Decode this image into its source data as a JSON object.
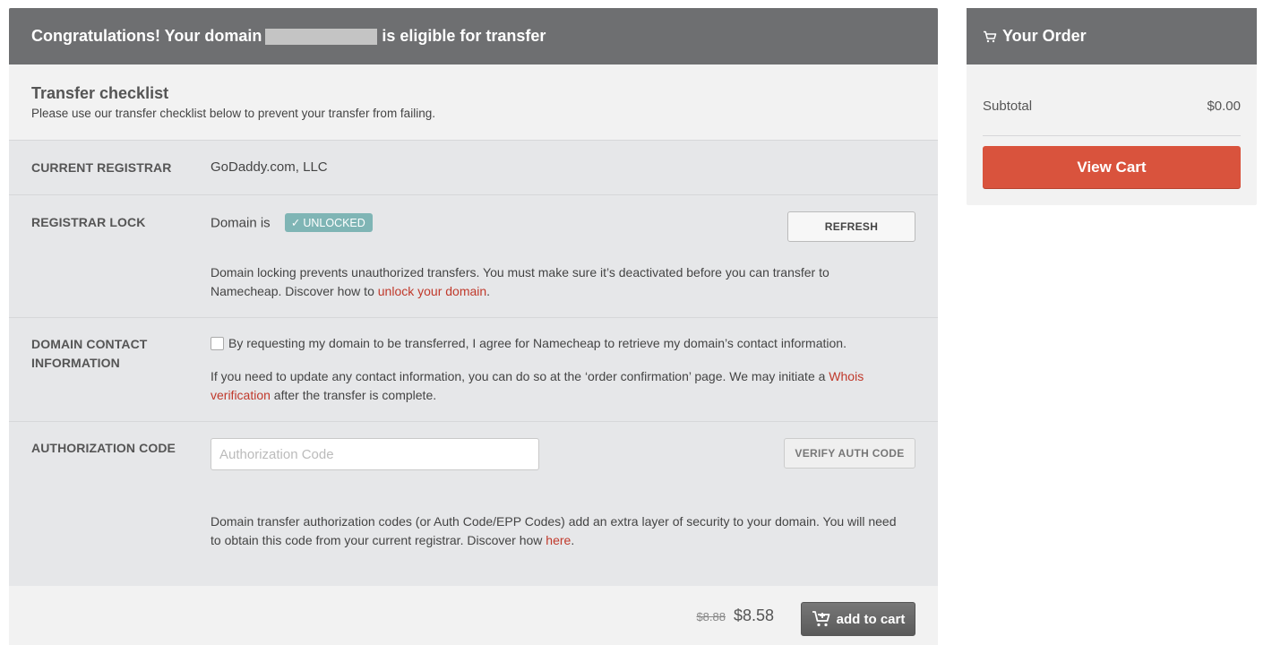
{
  "header": {
    "title_prefix": "Congratulations! Your domain",
    "title_suffix": "is eligible for transfer"
  },
  "intro": {
    "title": "Transfer checklist",
    "subtitle": "Please use our transfer checklist below to prevent your transfer from failing."
  },
  "registrar": {
    "label": "CURRENT REGISTRAR",
    "value": "GoDaddy.com, LLC"
  },
  "lock": {
    "label": "REGISTRAR LOCK",
    "status_prefix": "Domain is",
    "badge": "UNLOCKED",
    "badge_color": "#7fb5b5",
    "refresh_label": "REFRESH",
    "desc_before": "Domain locking prevents unauthorized transfers. You must make sure it’s deactivated before you can transfer to Namecheap. Discover how to ",
    "desc_link": "unlock your domain",
    "desc_after": "."
  },
  "contact": {
    "label": "DOMAIN CONTACT INFORMATION",
    "checkbox_label": "By requesting my domain to be transferred, I agree for Namecheap to retrieve my domain’s contact information.",
    "checkbox_checked": false,
    "desc_before": "If you need to update any contact information, you can do so at the ‘order confirmation’ page. We may initiate a ",
    "desc_link": "Whois verification",
    "desc_after": " after the transfer is complete."
  },
  "auth": {
    "label": "AUTHORIZATION CODE",
    "input_value": "",
    "input_placeholder": "Authorization Code",
    "verify_label": "VERIFY AUTH CODE",
    "desc_before": "Domain transfer authorization codes (or Auth Code/EPP Codes) add an extra layer of security to your domain. You will need to obtain this code from your current registrar. Discover how ",
    "desc_link": "here",
    "desc_after": "."
  },
  "footer": {
    "old_price": "$8.88",
    "new_price": "$8.58",
    "add_to_cart_label": "add to cart",
    "add_to_cart_icon": "cart-plus-icon"
  },
  "order": {
    "title": "Your Order",
    "title_icon": "cart-icon",
    "subtotal_label": "Subtotal",
    "subtotal_value": "$0.00",
    "view_cart_label": "View Cart",
    "view_cart_color": "#d9533d"
  },
  "colors": {
    "header_bg": "#6e6f71",
    "link": "#c0392b",
    "panel_bg": "#e6e7e9"
  }
}
